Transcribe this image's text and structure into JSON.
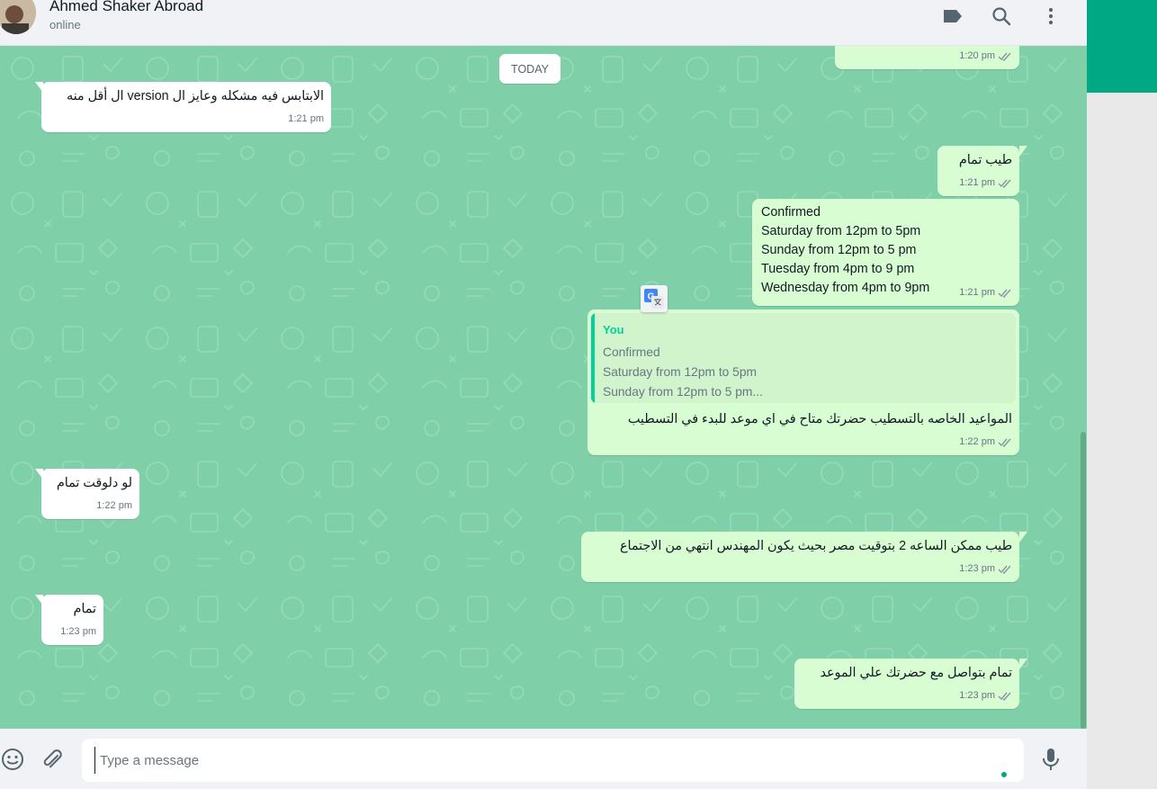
{
  "header": {
    "contact_name": "Ahmed Shaker Abroad",
    "status": "online",
    "icons": [
      "label-icon",
      "search-icon",
      "more-vertical-icon"
    ]
  },
  "chat": {
    "day_divider": "TODAY",
    "messages": [
      {
        "id": "m0",
        "direction": "out",
        "text": "",
        "time": "1:20 pm",
        "status": "read"
      },
      {
        "id": "m1",
        "direction": "in",
        "text": "الابتابس فيه مشكله وعايز ال version ال أقل منه",
        "time": "1:21 pm"
      },
      {
        "id": "m2",
        "direction": "out",
        "text": "طيب تمام",
        "time": "1:21 pm",
        "status": "read"
      },
      {
        "id": "m3",
        "direction": "out",
        "lines": [
          "Confirmed",
          "Saturday from 12pm to 5pm",
          "Sunday from 12pm to 5 pm",
          "Tuesday from 4pm to 9 pm",
          "Wednesday from 4pm to 9pm"
        ],
        "time": "1:21 pm",
        "status": "read"
      },
      {
        "id": "m4",
        "direction": "out",
        "quote": {
          "author": "You",
          "lines": [
            "Confirmed",
            "Saturday from 12pm to 5pm",
            "Sunday from 12pm to 5 pm..."
          ]
        },
        "text": "المواعيد الخاصه بالتسطيب حضرتك متاح في اي موعد للبدء في التسطيب",
        "time": "1:22 pm",
        "status": "read"
      },
      {
        "id": "m5",
        "direction": "in",
        "text": "لو دلوقت تمام",
        "time": "1:22 pm"
      },
      {
        "id": "m6",
        "direction": "out",
        "text": "طيب ممكن الساعه 2 بتوقيت مصر بحيث يكون المهندس انتهي من الاجتماع",
        "time": "1:23 pm",
        "status": "read"
      },
      {
        "id": "m7",
        "direction": "in",
        "text": "تمام",
        "time": "1:23 pm"
      },
      {
        "id": "m8",
        "direction": "out",
        "text": "تمام بتواصل مع حضرتك علي الموعد",
        "time": "1:23 pm",
        "status": "read"
      }
    ]
  },
  "footer": {
    "placeholder": "Type a message",
    "icons": [
      "emoji-icon",
      "attach-icon",
      "microphone-icon"
    ]
  },
  "colors": {
    "chat_background": "#7fd0a8",
    "incoming_bubble": "#ffffff",
    "outgoing_bubble": "#d9fdd3",
    "accent": "#00a884",
    "quote_accent": "#06cf9c"
  }
}
